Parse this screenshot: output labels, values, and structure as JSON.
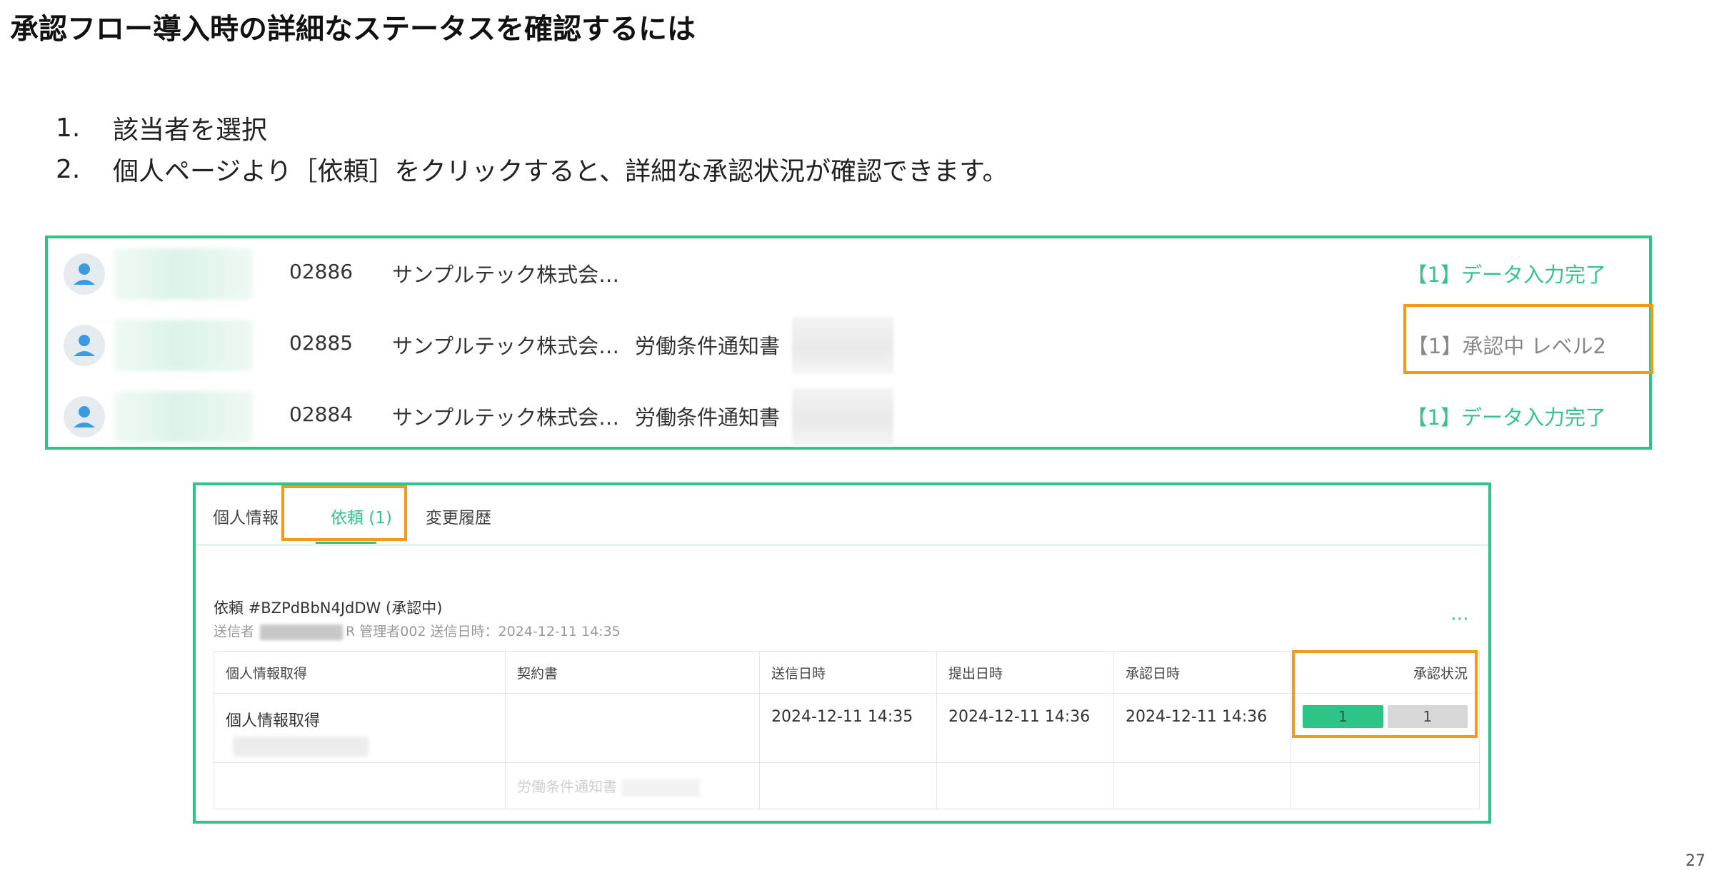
{
  "title": "承認フロー導入時の詳細なステータスを確認するには",
  "steps": [
    {
      "num": "1.",
      "text": "該当者を選択"
    },
    {
      "num": "2.",
      "text": "個人ページより［依頼］をクリックすると、詳細な承認状況が確認できます。"
    }
  ],
  "employees": [
    {
      "id": "02886",
      "company": "サンプルテック株式会…",
      "document": "",
      "status": "【1】データ入力完了"
    },
    {
      "id": "02885",
      "company": "サンプルテック株式会…",
      "document": "労働条件通知書",
      "status": "【1】承認中 レベル2"
    },
    {
      "id": "02884",
      "company": "サンプルテック株式会…",
      "document": "労働条件通知書",
      "status": "【1】データ入力完了"
    }
  ],
  "tabs": [
    {
      "label": "個人情報"
    },
    {
      "label": "依頼 (1)"
    },
    {
      "label": "変更履歴"
    }
  ],
  "request": {
    "title": "依頼 #BZPdBbN4JdDW (承認中)",
    "sender_label": "送信者",
    "sender_rest": "R 管理者002 送信日時：2024-12-11 14:35",
    "more_icon": "⋯"
  },
  "table": {
    "headers": [
      "個人情報取得",
      "契約書",
      "送信日時",
      "提出日時",
      "承認日時",
      "承認状況"
    ],
    "row1": {
      "item": "個人情報取得",
      "sent": "2024-12-11 14:35",
      "submitted": "2024-12-11 14:36",
      "approved": "2024-12-11 14:36",
      "approval_bars": [
        {
          "value": "1",
          "color": "#2ec488"
        },
        {
          "value": "1",
          "color": "#d7d7d7"
        }
      ]
    },
    "row2": {
      "contract": "労働条件通知書"
    }
  },
  "colors": {
    "accent_green": "#2ec488",
    "highlight_orange": "#f39a1a"
  },
  "page_number": "27"
}
